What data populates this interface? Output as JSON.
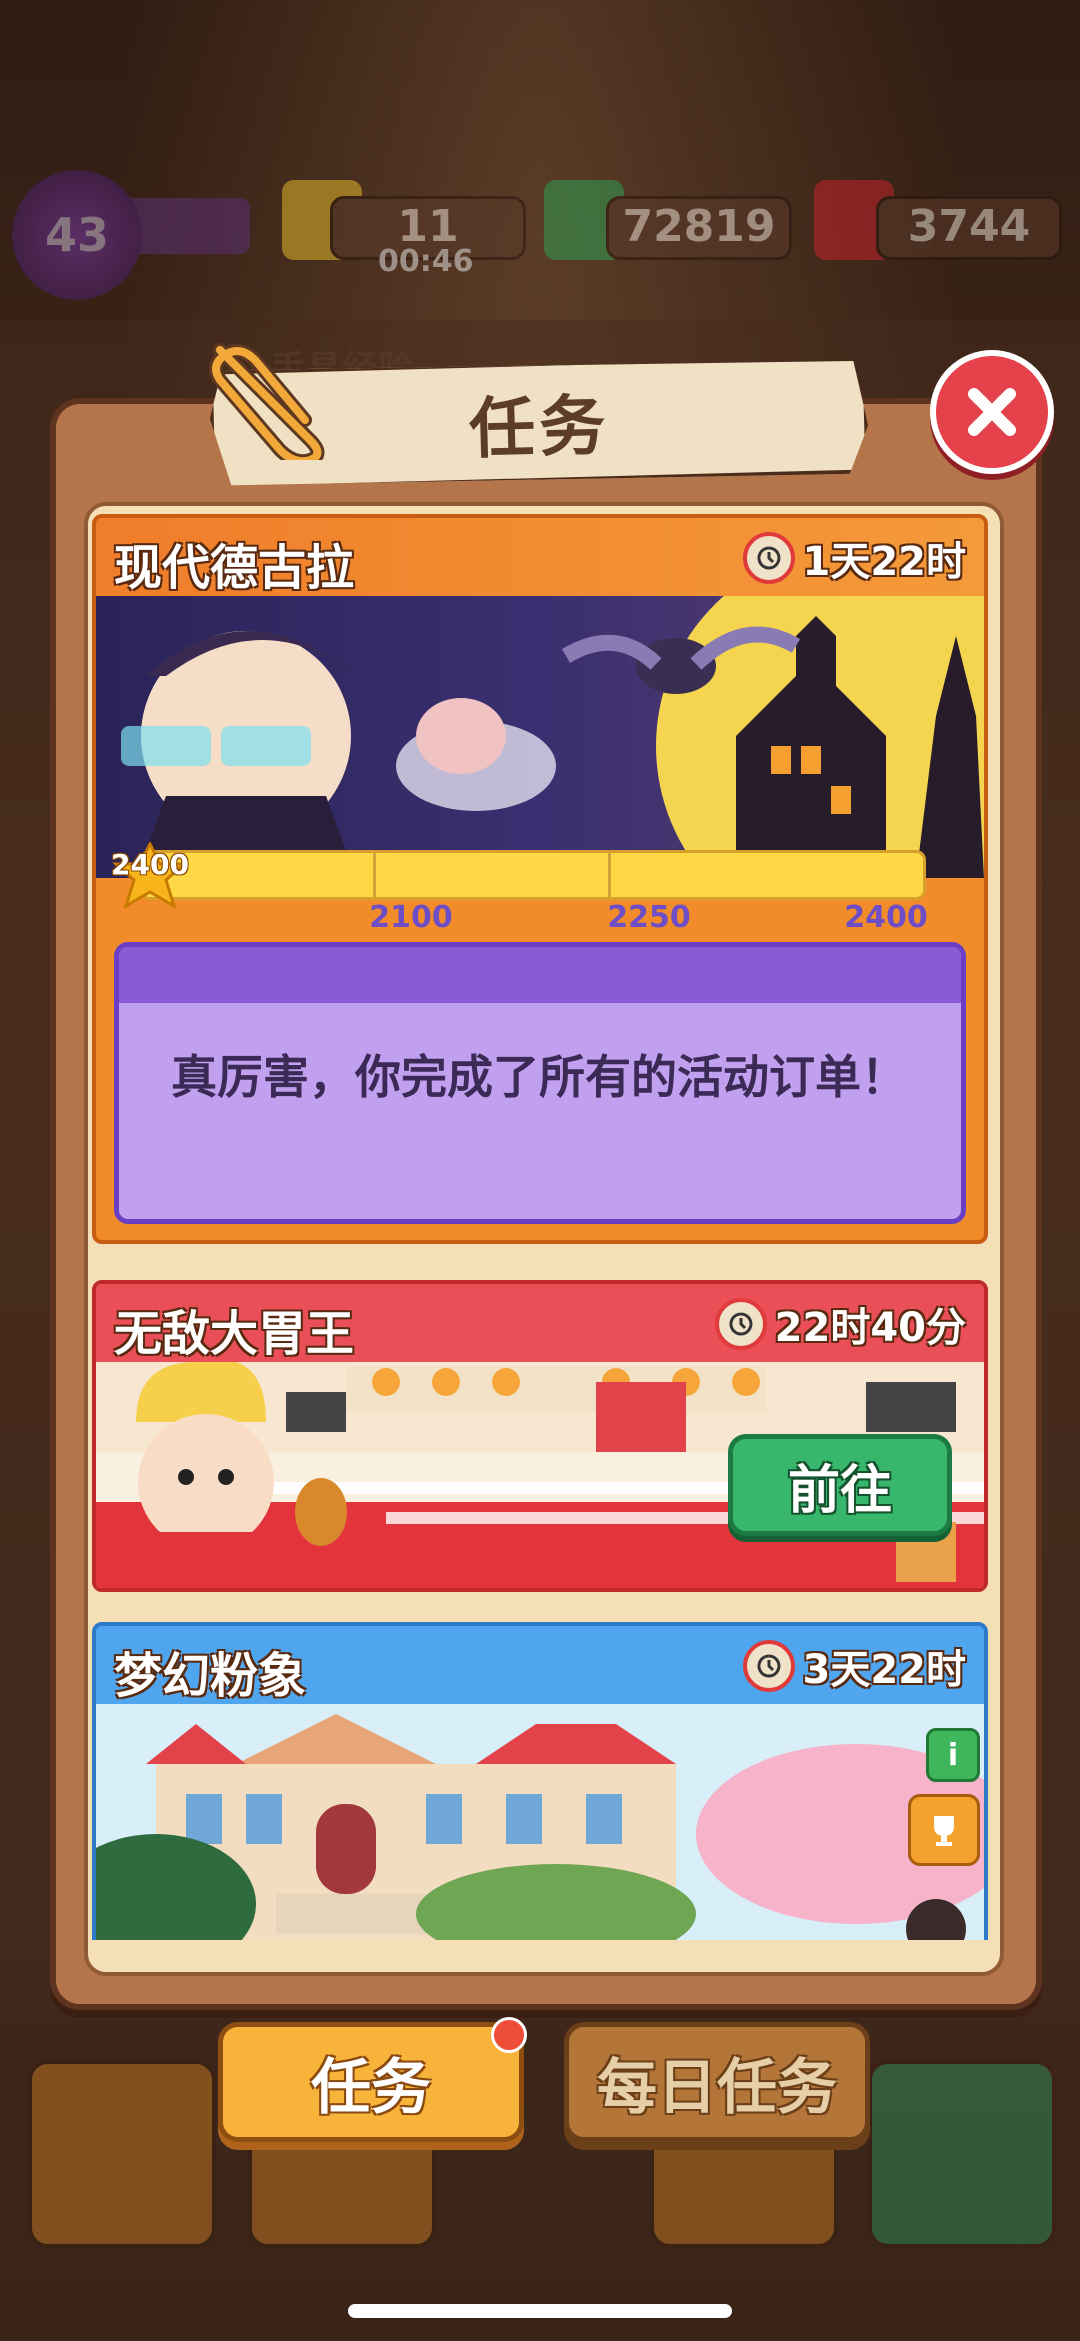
{
  "hud": {
    "level": "43",
    "energy": "11",
    "energy_timer": "00:46",
    "cash": "72819",
    "gems": "3744"
  },
  "background_partial_text": "手昌经验",
  "modal": {
    "title": "任务",
    "close_icon": "close-icon"
  },
  "events": [
    {
      "name": "现代德古拉",
      "timer": "1天22时",
      "theme_color": "#f28c2a",
      "progress": {
        "badge": "2400",
        "current": 2400,
        "milestones": [
          "2100",
          "2250",
          "2400"
        ]
      },
      "completion_message": "真厉害，你完成了所有的活动订单！"
    },
    {
      "name": "无敌大胃王",
      "timer": "22时40分",
      "theme_color": "#ea4f58",
      "go_button": "前往"
    },
    {
      "name": "梦幻粉象",
      "timer": "3天22时",
      "theme_color": "#4fa6ef",
      "info_icon": "i"
    }
  ],
  "tabs": {
    "missions": "任务",
    "daily": "每日任务"
  },
  "colors": {
    "close_red": "#e5414b",
    "go_green": "#37b66c",
    "active_tab": "#f8b33a"
  }
}
